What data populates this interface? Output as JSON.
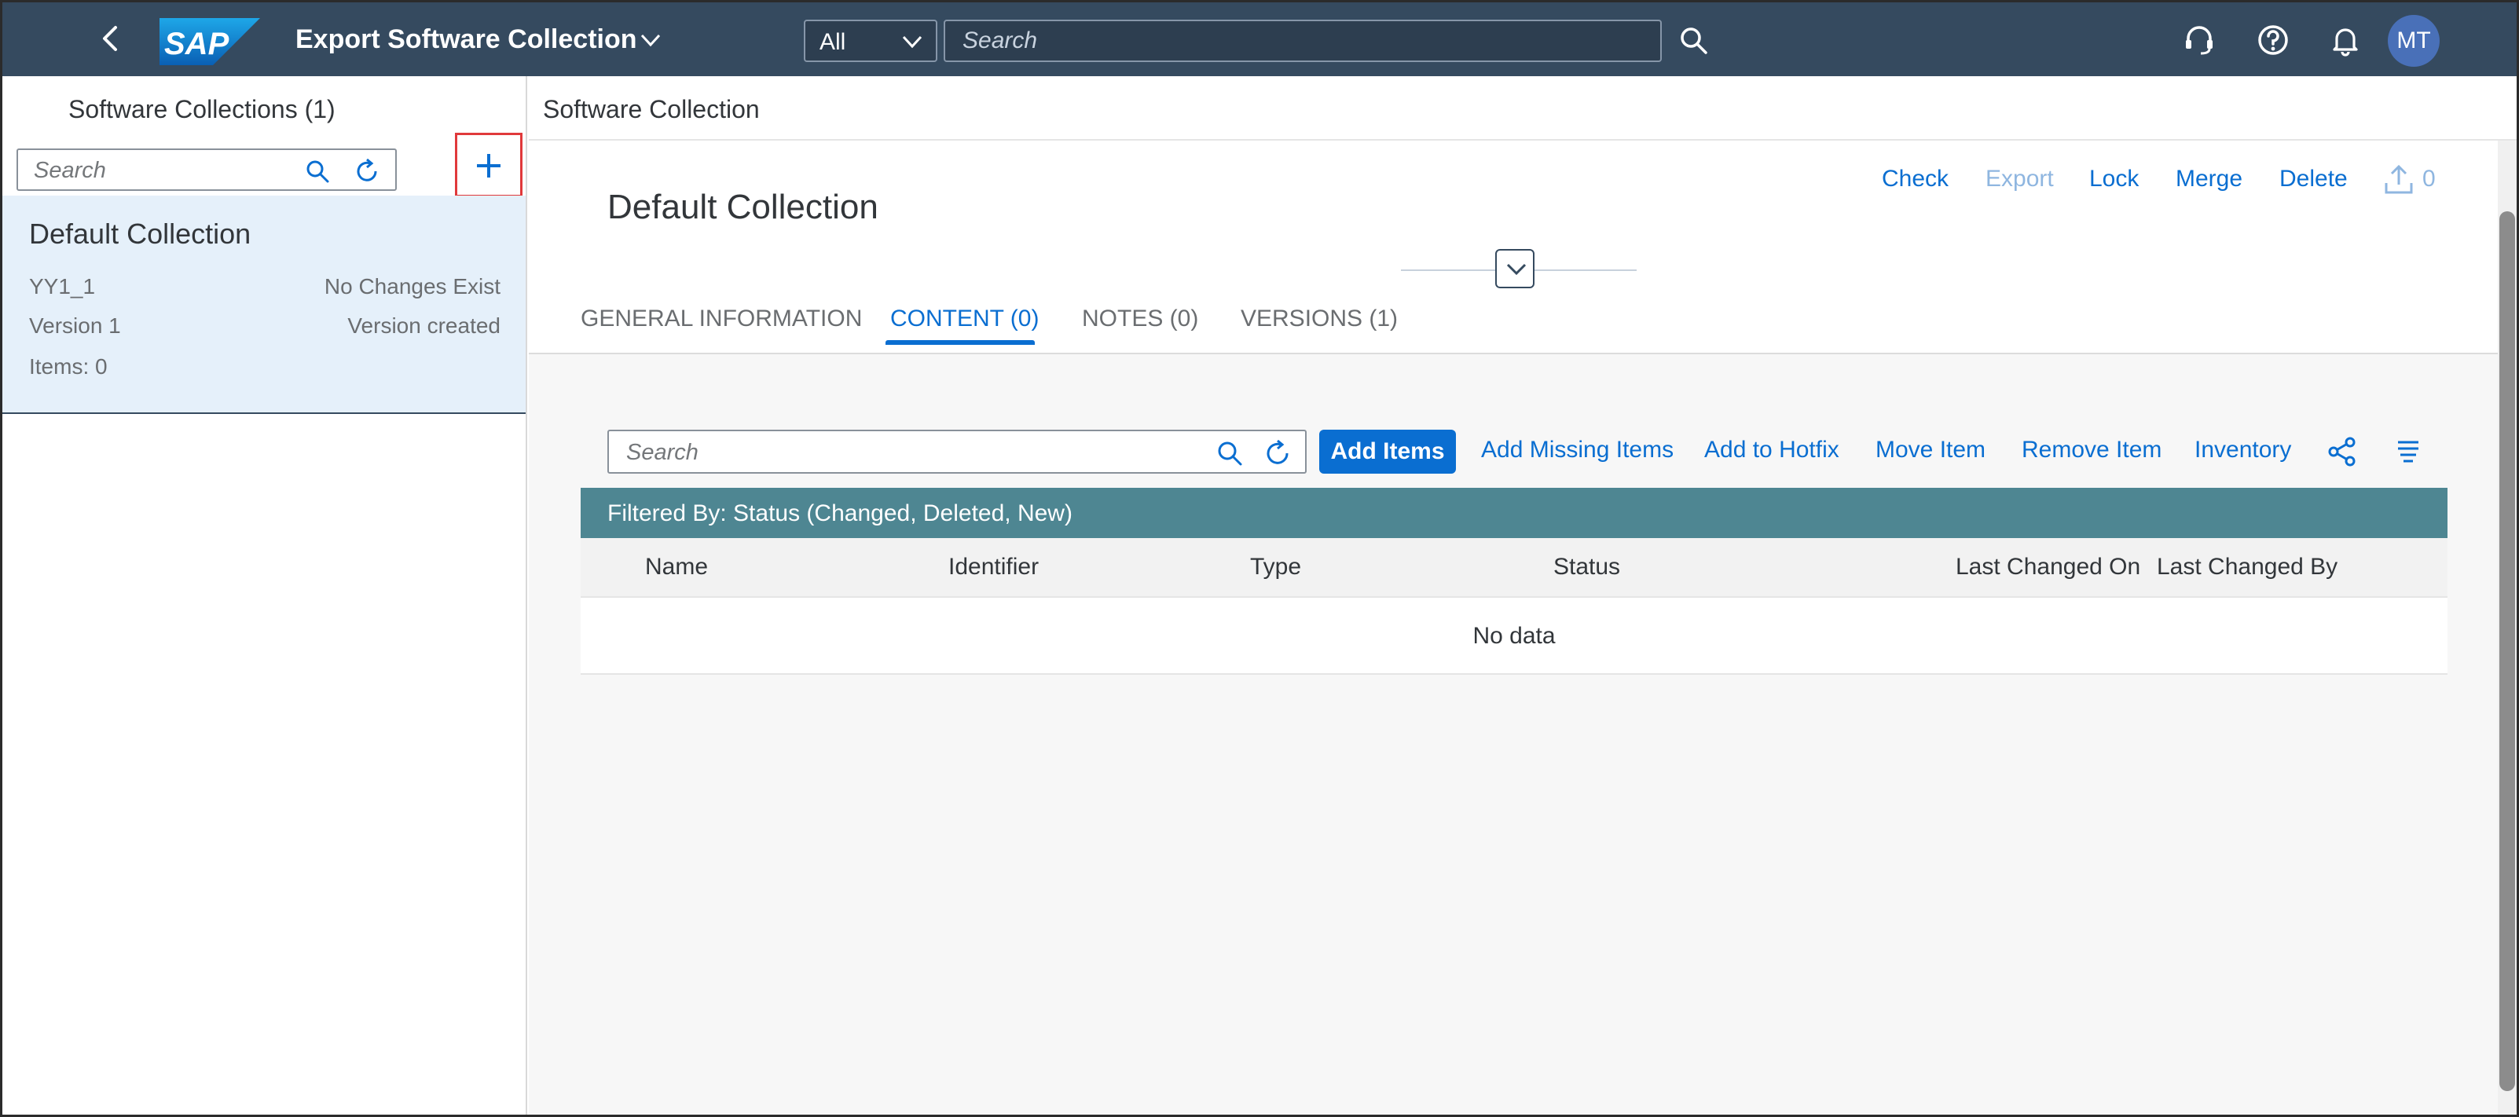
{
  "shell": {
    "app_title": "Export Software Collection",
    "logo_text": "SAP",
    "scope": "All",
    "search_placeholder": "Search",
    "avatar_initials": "MT",
    "brand_color": "#354a5f"
  },
  "master": {
    "title": "Software Collections (1)",
    "search_placeholder": "Search",
    "items": [
      {
        "title": "Default Collection",
        "attr1": "YY1_1",
        "status1": "No Changes Exist",
        "attr2": "Version 1",
        "status2": "Version created",
        "attr3": "Items: 0"
      }
    ]
  },
  "detail": {
    "header_title": "Software Collection",
    "object_title": "Default Collection",
    "actions": {
      "check": "Check",
      "export": "Export",
      "lock": "Lock",
      "merge": "Merge",
      "delete": "Delete",
      "upload_count": "0"
    },
    "tabs": [
      {
        "label": "GENERAL INFORMATION",
        "active": false
      },
      {
        "label": "CONTENT (0)",
        "active": true
      },
      {
        "label": "NOTES (0)",
        "active": false
      },
      {
        "label": "VERSIONS (1)",
        "active": false
      }
    ],
    "toolbar": {
      "search_placeholder": "Search",
      "add_items": "Add Items",
      "add_missing_items": "Add Missing Items",
      "add_to_hotfix": "Add to Hotfix",
      "move_item": "Move Item",
      "remove_item": "Remove Item",
      "inventory": "Inventory"
    },
    "table": {
      "filter_info": "Filtered By: Status (Changed, Deleted, New)",
      "columns": [
        "Name",
        "Identifier",
        "Type",
        "Status",
        "Last Changed On",
        "Last Changed By"
      ],
      "no_data": "No data",
      "info_bar_color": "#4e8692"
    }
  },
  "colors": {
    "accent": "#0a6ed1",
    "selected_item": "#e5f0fa",
    "highlight_border": "#e0393b"
  }
}
